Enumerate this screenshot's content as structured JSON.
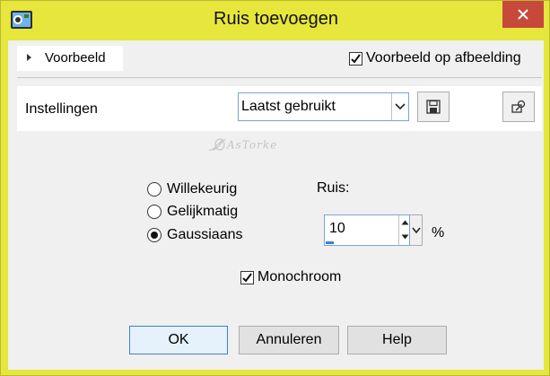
{
  "window": {
    "title": "Ruis toevoegen"
  },
  "preview": {
    "toggle_label": "Voorbeeld",
    "on_image_label": "Voorbeeld op afbeelding",
    "on_image_checked": true
  },
  "settings": {
    "label": "Instellingen",
    "preset_value": "Laatst gebruikt"
  },
  "watermark": {
    "text": "AsTorke"
  },
  "noise_type": {
    "options": [
      {
        "label": "Willekeurig",
        "selected": false
      },
      {
        "label": "Gelijkmatig",
        "selected": false
      },
      {
        "label": "Gaussiaans",
        "selected": true
      }
    ]
  },
  "noise": {
    "label": "Ruis:",
    "value": "10",
    "unit": "%"
  },
  "monochrome": {
    "label": "Monochroom",
    "checked": true
  },
  "buttons": {
    "ok": "OK",
    "cancel": "Annuleren",
    "help": "Help"
  },
  "colors": {
    "title_bar": "#e6e63c",
    "close_button": "#c7493a",
    "accent": "#3c7fd9",
    "dialog_bg": "#f0f0f0"
  }
}
